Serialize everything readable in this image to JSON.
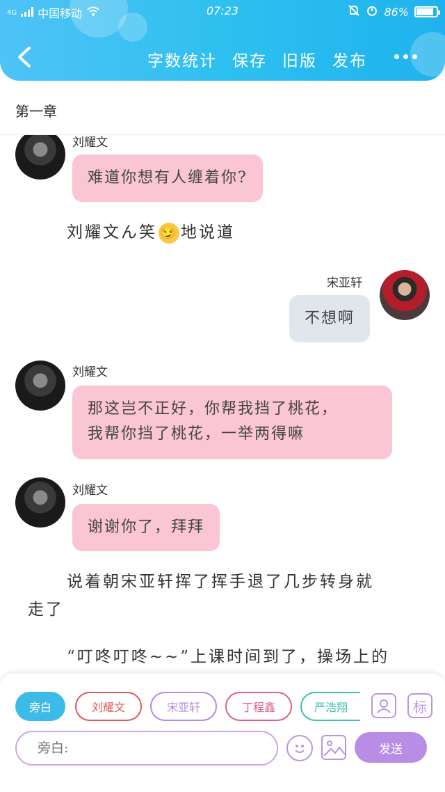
{
  "status": {
    "carrier": "中国移动",
    "network": "4G",
    "time": "07:23",
    "battery": "86%",
    "battery_level": 0.86
  },
  "toolbar": {
    "actions": [
      {
        "label": "字数统计"
      },
      {
        "label": "保存"
      },
      {
        "label": "旧版"
      },
      {
        "label": "发布"
      }
    ]
  },
  "chapter": {
    "title": "第一章"
  },
  "chat": {
    "msg1": {
      "name": "刘耀文",
      "text": "难道你想有人缠着你?"
    },
    "narr1": {
      "before": "刘耀文ん笑",
      "emoji": "😏",
      "after": "地说道"
    },
    "msg2": {
      "name": "宋亚轩",
      "text": "不想啊"
    },
    "msg3": {
      "name": "刘耀文",
      "line1": "那这岂不正好，你帮我挡了桃花，",
      "line2": "我帮你挡了桃花，一举两得嘛"
    },
    "msg4": {
      "name": "刘耀文",
      "text": "谢谢你了，拜拜"
    },
    "narr2": {
      "line1": "说着朝宋亚轩挥了挥手退了几步转身就",
      "line2": "走了"
    },
    "narr3": {
      "line1": "“叮咚叮咚~~”上课时间到了，操场上的"
    }
  },
  "bottom": {
    "roles": [
      {
        "label": "旁白",
        "color": "#3dbbe8"
      },
      {
        "label": "刘耀文",
        "color": "#e05a5a"
      },
      {
        "label": "宋亚轩",
        "color": "#b58ae0"
      },
      {
        "label": "丁程鑫",
        "color": "#e0608a"
      },
      {
        "label": "严浩翔",
        "color": "#3fbfae"
      }
    ],
    "tag_label": "标",
    "input_placeholder": "旁白:",
    "send_label": "发送"
  }
}
